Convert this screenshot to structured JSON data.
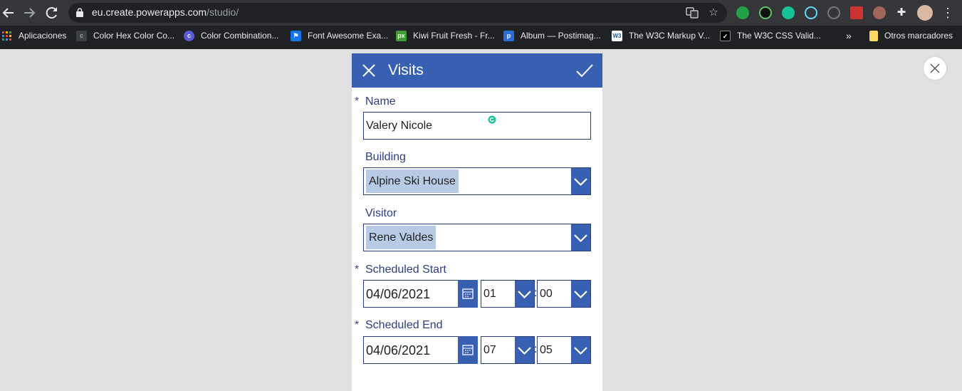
{
  "browser": {
    "url_host": "eu.create.powerapps.com",
    "url_path": "/studio/",
    "bookmarks": [
      {
        "label": "Aplicaciones",
        "icon": "apps-grid-icon",
        "color": "#4285f4"
      },
      {
        "label": "Color Hex Color Co...",
        "icon": "color-hex-icon",
        "color": "#5f6368"
      },
      {
        "label": "Color Combination...",
        "icon": "color-combination-icon",
        "color": "#5b5bd6"
      },
      {
        "label": "Font Awesome Exa...",
        "icon": "flag-icon",
        "color": "#1a73e8"
      },
      {
        "label": "Kiwi Fruit Fresh - Fr...",
        "icon": "px-icon",
        "color": "#3f9c35"
      },
      {
        "label": "Album — Postimag...",
        "icon": "postimage-icon",
        "color": "#2a6dd8"
      },
      {
        "label": "The W3C Markup V...",
        "icon": "w3c-icon",
        "color": "#ffffff"
      },
      {
        "label": "The W3C CSS Valid...",
        "icon": "w3c-css-icon",
        "color": "#000000"
      }
    ],
    "more_label": "»",
    "other_bookmarks": "Otros marcadores"
  },
  "form": {
    "title": "Visits",
    "header_color": "#3860b2",
    "required_mark": "*",
    "name": {
      "label": "Name",
      "value": "Valery Nicole"
    },
    "building": {
      "label": "Building",
      "value": "Alpine Ski House"
    },
    "visitor": {
      "label": "Visitor",
      "value": "Rene Valdes"
    },
    "scheduled_start": {
      "label": "Scheduled Start",
      "date": "04/06/2021",
      "hour": "01",
      "minute": "00"
    },
    "scheduled_end": {
      "label": "Scheduled End",
      "date": "04/06/2021",
      "hour": "07",
      "minute": "05"
    },
    "time_separator": ":"
  }
}
